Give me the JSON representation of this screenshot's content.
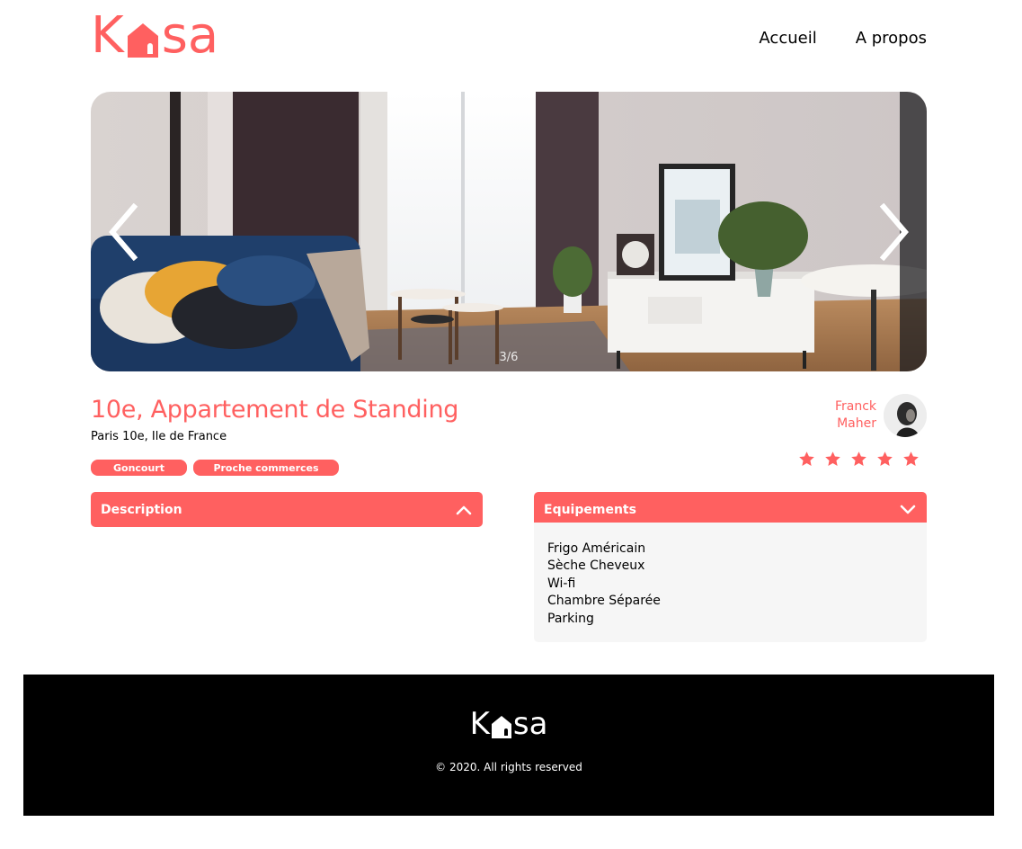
{
  "brand": {
    "logo_letters": [
      "K",
      "sa"
    ],
    "accent_color": "#FF6060",
    "logo_icon": "house-icon"
  },
  "nav": {
    "items": [
      {
        "label": "Accueil"
      },
      {
        "label": "A propos"
      }
    ]
  },
  "carousel": {
    "counter": "3/6",
    "prev_icon": "chevron-left-icon",
    "next_icon": "chevron-right-icon"
  },
  "listing": {
    "title": "10e, Appartement de Standing",
    "location": "Paris 10e, Ile de France",
    "tags": [
      "Goncourt",
      "Proche commerces"
    ],
    "host": {
      "first_name": "Franck",
      "last_name": "Maher"
    },
    "rating": 5,
    "rating_max": 5
  },
  "sections": {
    "description": {
      "title": "Description",
      "expanded": false,
      "icon": "chevron-up-icon"
    },
    "equipments": {
      "title": "Equipements",
      "expanded": true,
      "icon": "chevron-down-icon",
      "items": [
        "Frigo Américain",
        "Sèche Cheveux",
        "Wi-fi",
        "Chambre Séparée",
        "Parking"
      ]
    }
  },
  "footer": {
    "copyright": "© 2020. All rights reserved",
    "background": "#000000"
  }
}
